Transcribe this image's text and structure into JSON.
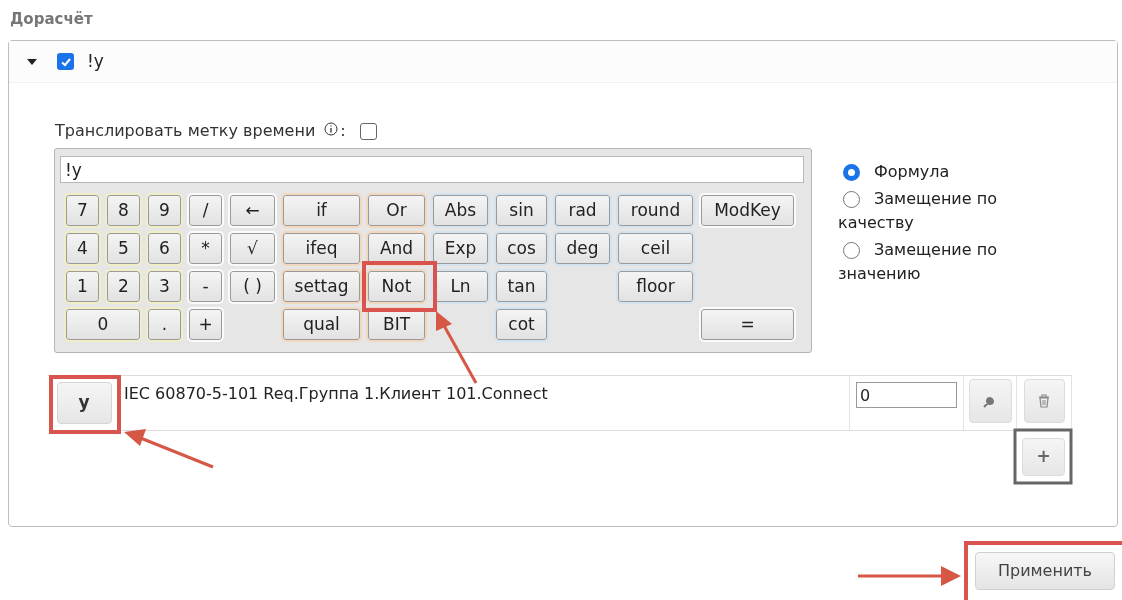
{
  "section_title": "Дорасчёт",
  "item": {
    "expanded": true,
    "enabled": true,
    "name": "!y"
  },
  "timestamp": {
    "label": "Транслировать метку времени",
    "suffix": ":",
    "checked": false
  },
  "formula": {
    "value": "!y"
  },
  "keypad": [
    [
      {
        "label": "7",
        "kind": "digit"
      },
      {
        "label": "8",
        "kind": "digit"
      },
      {
        "label": "9",
        "kind": "digit"
      },
      {
        "label": "/",
        "kind": "plain"
      },
      {
        "label": "←",
        "kind": "plain"
      },
      {
        "label": "if",
        "kind": "logic"
      },
      {
        "label": "Or",
        "kind": "logic"
      },
      {
        "label": "Abs",
        "kind": "function"
      },
      {
        "label": "sin",
        "kind": "function"
      },
      {
        "label": "rad",
        "kind": "function"
      },
      {
        "label": "round",
        "kind": "function"
      },
      {
        "label": "ModKey",
        "kind": "plain"
      }
    ],
    [
      {
        "label": "4",
        "kind": "digit"
      },
      {
        "label": "5",
        "kind": "digit"
      },
      {
        "label": "6",
        "kind": "digit"
      },
      {
        "label": "*",
        "kind": "plain"
      },
      {
        "label": "√",
        "kind": "plain"
      },
      {
        "label": "ifeq",
        "kind": "logic"
      },
      {
        "label": "And",
        "kind": "logic"
      },
      {
        "label": "Exp",
        "kind": "function"
      },
      {
        "label": "cos",
        "kind": "function"
      },
      {
        "label": "deg",
        "kind": "function"
      },
      {
        "label": "ceil",
        "kind": "function"
      }
    ],
    [
      {
        "label": "1",
        "kind": "digit"
      },
      {
        "label": "2",
        "kind": "digit"
      },
      {
        "label": "3",
        "kind": "digit"
      },
      {
        "label": "-",
        "kind": "plain"
      },
      {
        "label": "( )",
        "kind": "plain"
      },
      {
        "label": "settag",
        "kind": "logic"
      },
      {
        "label": "Not",
        "kind": "logic"
      },
      {
        "label": "Ln",
        "kind": "function"
      },
      {
        "label": "tan",
        "kind": "function"
      },
      {
        "label": "floor",
        "kind": "function"
      }
    ],
    [
      {
        "label": "0",
        "kind": "digit"
      },
      {
        "label": ".",
        "kind": "digit"
      },
      {
        "label": "+",
        "kind": "plain"
      },
      {
        "label": "qual",
        "kind": "logic"
      },
      {
        "label": "BIT",
        "kind": "logic"
      },
      {
        "label": "cot",
        "kind": "function"
      },
      {
        "label": "=",
        "kind": "plain"
      }
    ]
  ],
  "modes": [
    {
      "label": "Формула",
      "selected": true
    },
    {
      "label": "Замещение по качеству",
      "selected": false
    },
    {
      "label": "Замещение по значению",
      "selected": false
    }
  ],
  "variables": [
    {
      "name": "y",
      "tag": "IEC 60870-5-101 Req.Группа 1.Клиент 101.Connect",
      "value": "0"
    }
  ],
  "add_button": "+",
  "apply_button": "Применить"
}
